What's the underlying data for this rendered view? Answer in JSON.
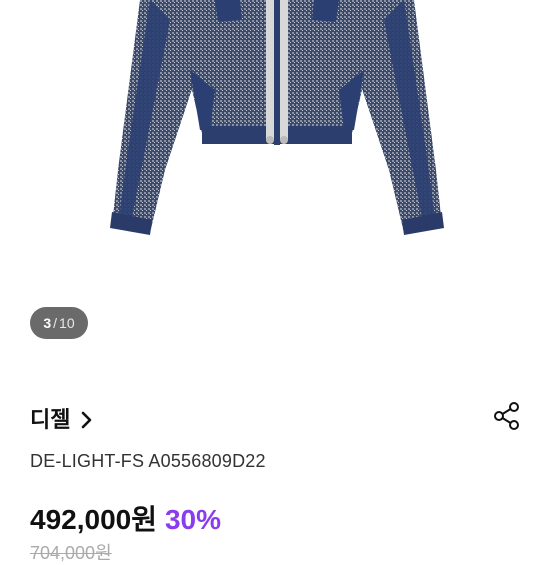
{
  "gallery": {
    "current": "3",
    "separator": "/",
    "total": "10",
    "image_icon": "denim-jacket-photo"
  },
  "product": {
    "brand": "디젤",
    "brand_chevron_icon": "chevron-right-icon",
    "share_icon": "share-icon",
    "model": "DE-LIGHT-FS A0556809D22",
    "price": "492,000원",
    "discount": "30%",
    "original_price": "704,000원"
  },
  "colors": {
    "discount": "#8a3cf0",
    "counter_bg": "#6a6a6a",
    "original_price": "#aaaaaa"
  }
}
